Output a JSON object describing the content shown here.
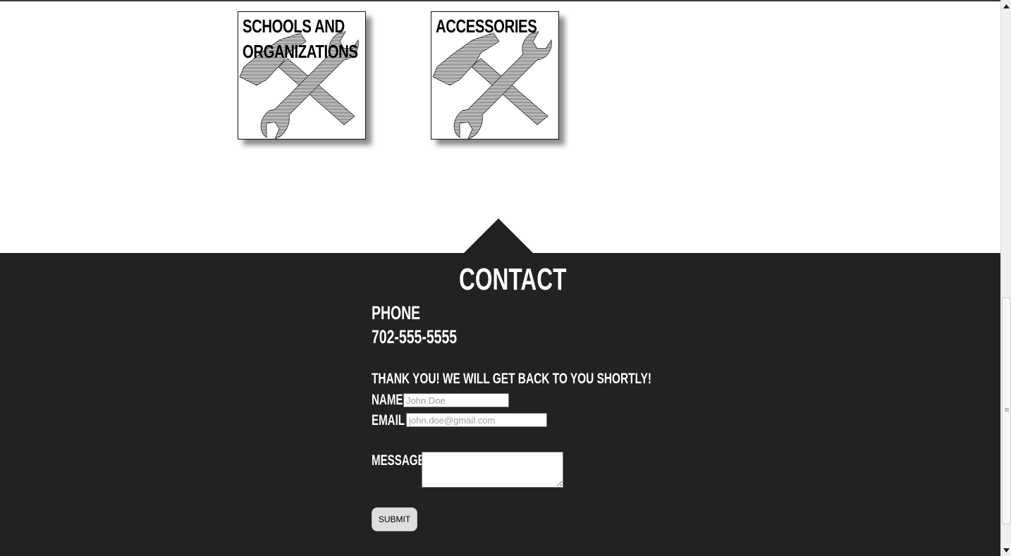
{
  "categories": [
    {
      "title": "Schools and Organizations",
      "icon": "tools-icon"
    },
    {
      "title": "Accessories",
      "icon": "tools-icon"
    }
  ],
  "contact": {
    "heading": "Contact",
    "phone_label": "Phone",
    "phone_number": "702-555-5555",
    "thanks_message": "Thank you! We will get back to you shortly!",
    "name_label": "Name",
    "name_placeholder": "John Doe",
    "email_label": "Email",
    "email_placeholder": "john.doe@gmail.com",
    "message_label": "Message",
    "submit_label": "Submit"
  },
  "colors": {
    "section_background": "#222222",
    "page_background": "#ffffff",
    "text_on_dark": "#ffffff"
  },
  "scrollbar": {
    "up_icon": "scroll-up-arrow-icon",
    "down_icon": "scroll-down-arrow-icon"
  }
}
